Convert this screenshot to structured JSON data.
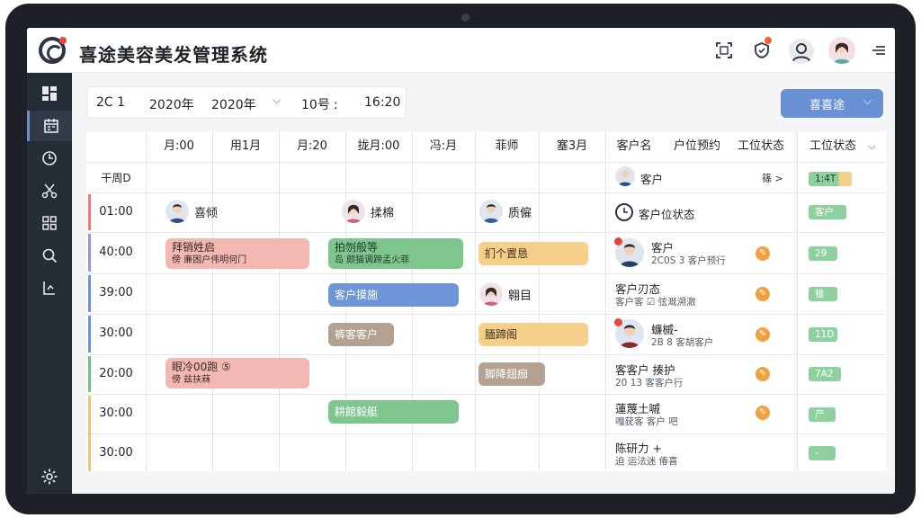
{
  "app": {
    "title": "喜途美容美发管理系统"
  },
  "header_icons": [
    "scan-icon",
    "shield-icon",
    "user-icon",
    "avatar",
    "menu-icon"
  ],
  "sidebar": {
    "items": [
      "dashboard-icon",
      "calendar-icon",
      "clock-icon",
      "scissors-icon",
      "grid-icon",
      "search-icon",
      "report-icon"
    ],
    "settings_icon": "gear-icon"
  },
  "datebar": {
    "a": "2C 1",
    "b": "2020年",
    "c": "2020年",
    "d": "10号 ː",
    "e": "16:20"
  },
  "primary_button": {
    "label": "喜喜途"
  },
  "columns": [
    "月:00",
    "用1月",
    "月:20",
    "拢月:00",
    "冯:月",
    "菲师",
    "塞3月"
  ],
  "first_row_label": "干周D",
  "times": [
    "01:00",
    "40:00",
    "39:00",
    "30:00",
    "20:00",
    "30:00",
    "30:00"
  ],
  "staff": [
    {
      "name": "喜倾"
    },
    {
      "name": "揉棉"
    },
    {
      "name": "质僱"
    }
  ],
  "appointments": {
    "a1": {
      "line1": "拜销姓启",
      "line2": "傍   亷困户伟明何门"
    },
    "a2": {
      "line1": "拍刎般等",
      "line2": "岛   颇猫调蹄孟火菲"
    },
    "a3": {
      "line1": "扪个置恳"
    },
    "a4": {
      "line1": "客户摸施"
    },
    "a5": {
      "name": "翱目"
    },
    "a6": {
      "line1": "裤客客户"
    },
    "a7": {
      "line1": "腼蹄阁"
    },
    "a8": {
      "line1": "眼冷00跑 ⑤",
      "line2": "傍   兹扶菻"
    },
    "a9": {
      "line1": "脚降翅痂"
    },
    "a10": {
      "line1": "耕館毅艇"
    }
  },
  "customer_panel": {
    "headers": [
      "客户名",
      "户位预约",
      "工位状态"
    ],
    "top_label": "客户",
    "status_row": "客户位状态",
    "rows": [
      {
        "name": "客户",
        "sub": "2C0S 3 客户预行"
      },
      {
        "name": "客户刃态",
        "sub": "客户客 ☑  弦溉溯澈"
      },
      {
        "name": "蠊槭-",
        "sub": "2B  8 客胡客户"
      },
      {
        "name": "客客户 揍护",
        "sub": "20 13 客客户行"
      },
      {
        "name": "蓮蔑土嘁",
        "sub": "嘎莸客   客户 吧"
      },
      {
        "name": "陈研力 +",
        "sub": "   迫  运法迷   偆喜"
      }
    ]
  },
  "status_panel": {
    "header": "工位状态",
    "link": "篠 >",
    "pills": [
      "1:4T",
      "客户",
      "29",
      "锥",
      "11D",
      "7A2",
      "产",
      "-"
    ]
  },
  "colors": {
    "red": "#f2b6b0",
    "green": "#7cc28a",
    "blue": "#6e95d6",
    "orange": "#f5cf84",
    "brown": "#b3a291",
    "pill_green": "#8fd19e"
  }
}
